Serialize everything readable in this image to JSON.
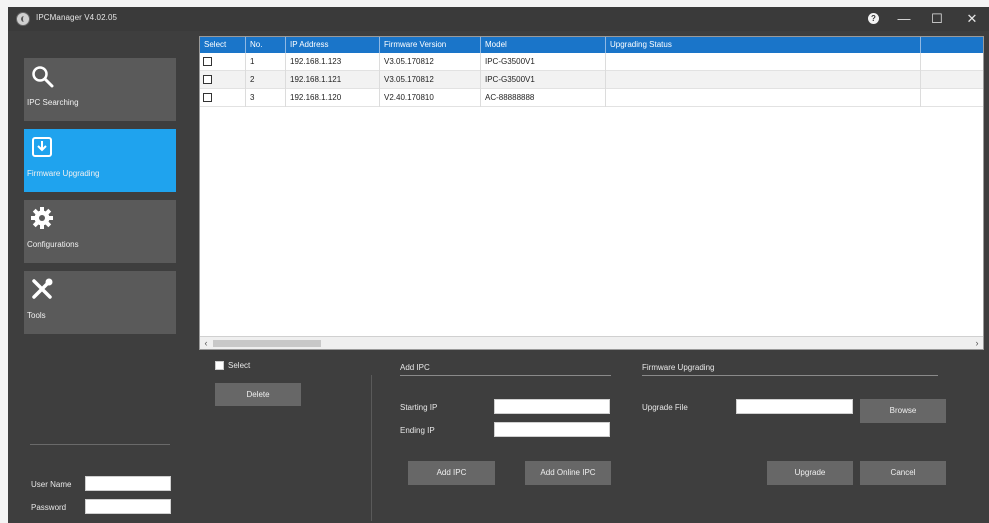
{
  "titlebar": {
    "title": "IPCManager V4.02.05",
    "help": "?",
    "minimize": "—",
    "maximize": "☐",
    "close": "✕"
  },
  "nav": [
    {
      "label": "IPC Searching",
      "icon": "search-icon"
    },
    {
      "label": "Firmware Upgrading",
      "icon": "upload-icon"
    },
    {
      "label": "Configurations",
      "icon": "gear-icon"
    },
    {
      "label": "Tools",
      "icon": "tools-icon"
    }
  ],
  "table": {
    "headers": [
      "Select",
      "No.",
      "IP Address",
      "Firmware Version",
      "Model",
      "Upgrading Status"
    ],
    "rows": [
      {
        "no": "1",
        "ip": "192.168.1.123",
        "fw": "V3.05.170812",
        "model": "IPC-G3500V1",
        "status": ""
      },
      {
        "no": "2",
        "ip": "192.168.1.121",
        "fw": "V3.05.170812",
        "model": "IPC-G3500V1",
        "status": ""
      },
      {
        "no": "3",
        "ip": "192.168.1.120",
        "fw": "V2.40.170810",
        "model": "AC-88888888",
        "status": ""
      }
    ]
  },
  "controls": {
    "select_label": "Select",
    "delete": "Delete",
    "add_ipc_title": "Add IPC",
    "starting_ip_label": "Starting IP",
    "ending_ip_label": "Ending IP",
    "starting_ip_value": "",
    "ending_ip_value": "",
    "add_ipc": "Add IPC",
    "add_online_ipc": "Add Online IPC",
    "fw_title": "Firmware Upgrading",
    "upgrade_file_label": "Upgrade File",
    "upgrade_file_value": "",
    "browse": "Browse",
    "upgrade": "Upgrade",
    "cancel": "Cancel"
  },
  "login": {
    "user_label": "User Name",
    "password_label": "Password",
    "user_value": "",
    "password_value": ""
  },
  "colors": {
    "active_nav": "#1fa3ee",
    "header": "#1a75c9",
    "bg": "#3e3e3e"
  }
}
